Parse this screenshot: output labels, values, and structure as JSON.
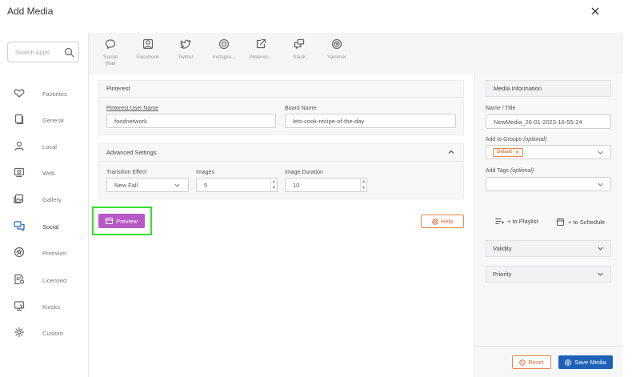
{
  "dialog": {
    "title": "Add Media"
  },
  "search": {
    "placeholder": "Search Apps"
  },
  "sidebar": {
    "items": [
      {
        "label": "Favorites",
        "icon": "favorites-icon"
      },
      {
        "label": "General",
        "icon": "general-icon"
      },
      {
        "label": "Local",
        "icon": "local-icon"
      },
      {
        "label": "Web",
        "icon": "web-icon"
      },
      {
        "label": "Gallery",
        "icon": "gallery-icon"
      },
      {
        "label": "Social",
        "icon": "social-icon",
        "active": true
      },
      {
        "label": "Premium",
        "icon": "premium-icon"
      },
      {
        "label": "Licensed",
        "icon": "licensed-icon"
      },
      {
        "label": "Kiosks",
        "icon": "kiosks-icon"
      },
      {
        "label": "Custom",
        "icon": "custom-icon"
      }
    ]
  },
  "apps": [
    {
      "label1": "Social",
      "label2": "Wall",
      "icon": "social-wall-icon"
    },
    {
      "label1": "Facebook",
      "label2": "",
      "icon": "facebook-icon"
    },
    {
      "label1": "Twitter",
      "label2": "",
      "icon": "twitter-icon"
    },
    {
      "label1": "Instagra...",
      "label2": "",
      "icon": "instagram-icon"
    },
    {
      "label1": "Pinteres...",
      "label2": "",
      "icon": "pinterest-icon",
      "active": true
    },
    {
      "label1": "Slack",
      "label2": "",
      "icon": "slack-icon"
    },
    {
      "label1": "Yammer",
      "label2": "",
      "icon": "yammer-icon"
    }
  ],
  "pinterest": {
    "heading": "Pinterest",
    "user_label": "Pinterest User Name",
    "user_value": "foodnetwork",
    "board_label": "Board Name",
    "board_value": "lets-cook-recipe-of-the-day"
  },
  "advanced": {
    "heading": "Advanced Settings",
    "transition_label": "Transition Effect",
    "transition_value": "New Fall",
    "images_label": "Images",
    "images_value": "5",
    "duration_label": "Image Duration",
    "duration_value": "10"
  },
  "actions": {
    "preview": "Preview",
    "help": "Help"
  },
  "media_info": {
    "heading": "Media Information",
    "name_label": "Name / Title",
    "name_value": "NewMedia_26-01-2023-16-55-24",
    "groups_label": "Add to Groups",
    "groups_optional": "(optional)",
    "group_tag": "Default",
    "tags_label": "Add Tags",
    "tags_optional": "(optional)",
    "playlist": "+ to Playlist",
    "schedule": "+ to Schedule",
    "validity": "Validity",
    "priority": "Priority"
  },
  "footer": {
    "reset": "Reset",
    "save": "Save Media"
  },
  "colors": {
    "accent": "#1d62b8",
    "preview": "#b65ac6",
    "warning": "#e8864a",
    "highlight": "#34e02b"
  }
}
